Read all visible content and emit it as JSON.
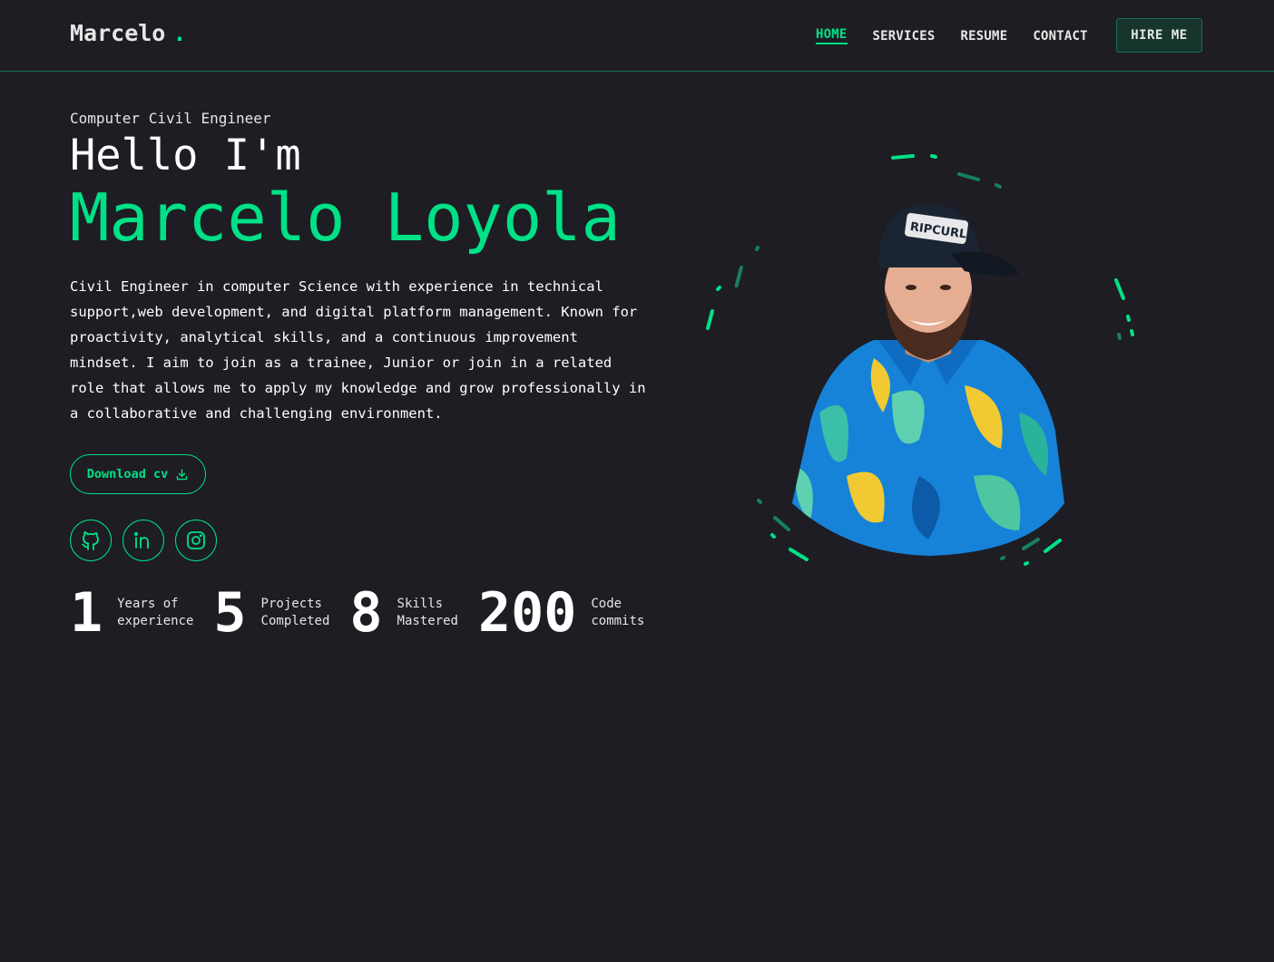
{
  "header": {
    "logo": "Marcelo",
    "logo_dot": ".",
    "nav": [
      {
        "label": "HOME",
        "active": true
      },
      {
        "label": "SERVICES",
        "active": false
      },
      {
        "label": "RESUME",
        "active": false
      },
      {
        "label": "CONTACT",
        "active": false
      }
    ],
    "hire_label": "HIRE ME"
  },
  "hero": {
    "subtitle": "Computer Civil Engineer",
    "greeting": "Hello I'm",
    "name": "Marcelo Loyola",
    "bio": "Civil Engineer in computer Science with experience in technical support,web development, and digital platform management. Known for proactivity, analytical skills, and a continuous improvement mindset. I aim to join as a trainee, Junior or join in a related role that allows me to apply my knowledge and grow professionally in a collaborative and challenging environment.",
    "download_label": "Download cv"
  },
  "socials": [
    {
      "icon": "github-icon"
    },
    {
      "icon": "linkedin-icon"
    },
    {
      "icon": "instagram-icon"
    }
  ],
  "stats": [
    {
      "number": "1",
      "label_line1": "Years of",
      "label_line2": "experience"
    },
    {
      "number": "5",
      "label_line1": "Projects",
      "label_line2": "Completed"
    },
    {
      "number": "8",
      "label_line1": "Skills",
      "label_line2": "Mastered"
    },
    {
      "number": "200",
      "label_line1": "Code",
      "label_line2": "commits"
    }
  ],
  "portrait": {
    "cap_text": "RIPCURL"
  },
  "colors": {
    "accent": "#00e187",
    "background": "#1d1d23",
    "hire_bg": "#16352c"
  }
}
